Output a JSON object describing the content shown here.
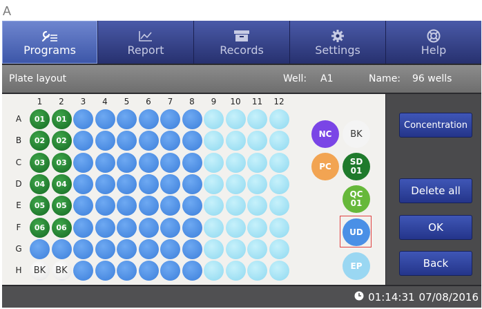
{
  "figure_label": "A",
  "nav": {
    "tabs": [
      {
        "label": "Programs",
        "icon": "wrench-icon",
        "active": true
      },
      {
        "label": "Report",
        "icon": "chart-icon",
        "active": false
      },
      {
        "label": "Records",
        "icon": "archive-icon",
        "active": false
      },
      {
        "label": "Settings",
        "icon": "gear-icon",
        "active": false
      },
      {
        "label": "Help",
        "icon": "lifebuoy-icon",
        "active": false
      }
    ]
  },
  "header": {
    "title": "Plate layout",
    "well_label": "Well:",
    "well_value": "A1",
    "name_label": "Name:",
    "name_value": "96 wells"
  },
  "plate": {
    "columns": [
      "1",
      "2",
      "3",
      "4",
      "5",
      "6",
      "7",
      "8",
      "9",
      "10",
      "11",
      "12"
    ],
    "rows": [
      "A",
      "B",
      "C",
      "D",
      "E",
      "F",
      "G",
      "H"
    ],
    "cells": [
      [
        {
          "type": "std",
          "text": "01"
        },
        {
          "type": "std",
          "text": "01"
        },
        {
          "type": "blue",
          "text": ""
        },
        {
          "type": "blue",
          "text": ""
        },
        {
          "type": "blue",
          "text": ""
        },
        {
          "type": "blue",
          "text": ""
        },
        {
          "type": "blue",
          "text": ""
        },
        {
          "type": "blue",
          "text": ""
        },
        {
          "type": "cyan",
          "text": ""
        },
        {
          "type": "cyan",
          "text": ""
        },
        {
          "type": "cyan",
          "text": ""
        },
        {
          "type": "cyan",
          "text": ""
        }
      ],
      [
        {
          "type": "std",
          "text": "02"
        },
        {
          "type": "std",
          "text": "02"
        },
        {
          "type": "blue",
          "text": ""
        },
        {
          "type": "blue",
          "text": ""
        },
        {
          "type": "blue",
          "text": ""
        },
        {
          "type": "blue",
          "text": ""
        },
        {
          "type": "blue",
          "text": ""
        },
        {
          "type": "blue",
          "text": ""
        },
        {
          "type": "cyan",
          "text": ""
        },
        {
          "type": "cyan",
          "text": ""
        },
        {
          "type": "cyan",
          "text": ""
        },
        {
          "type": "cyan",
          "text": ""
        }
      ],
      [
        {
          "type": "std",
          "text": "03"
        },
        {
          "type": "std",
          "text": "03"
        },
        {
          "type": "blue",
          "text": ""
        },
        {
          "type": "blue",
          "text": ""
        },
        {
          "type": "blue",
          "text": ""
        },
        {
          "type": "blue",
          "text": ""
        },
        {
          "type": "blue",
          "text": ""
        },
        {
          "type": "blue",
          "text": ""
        },
        {
          "type": "cyan",
          "text": ""
        },
        {
          "type": "cyan",
          "text": ""
        },
        {
          "type": "cyan",
          "text": ""
        },
        {
          "type": "cyan",
          "text": ""
        }
      ],
      [
        {
          "type": "std",
          "text": "04"
        },
        {
          "type": "std",
          "text": "04"
        },
        {
          "type": "blue",
          "text": ""
        },
        {
          "type": "blue",
          "text": ""
        },
        {
          "type": "blue",
          "text": ""
        },
        {
          "type": "blue",
          "text": ""
        },
        {
          "type": "blue",
          "text": ""
        },
        {
          "type": "blue",
          "text": ""
        },
        {
          "type": "cyan",
          "text": ""
        },
        {
          "type": "cyan",
          "text": ""
        },
        {
          "type": "cyan",
          "text": ""
        },
        {
          "type": "cyan",
          "text": ""
        }
      ],
      [
        {
          "type": "std",
          "text": "05"
        },
        {
          "type": "std",
          "text": "05"
        },
        {
          "type": "blue",
          "text": ""
        },
        {
          "type": "blue",
          "text": ""
        },
        {
          "type": "blue",
          "text": ""
        },
        {
          "type": "blue",
          "text": ""
        },
        {
          "type": "blue",
          "text": ""
        },
        {
          "type": "blue",
          "text": ""
        },
        {
          "type": "cyan",
          "text": ""
        },
        {
          "type": "cyan",
          "text": ""
        },
        {
          "type": "cyan",
          "text": ""
        },
        {
          "type": "cyan",
          "text": ""
        }
      ],
      [
        {
          "type": "std",
          "text": "06"
        },
        {
          "type": "std",
          "text": "06"
        },
        {
          "type": "blue",
          "text": ""
        },
        {
          "type": "blue",
          "text": ""
        },
        {
          "type": "blue",
          "text": ""
        },
        {
          "type": "blue",
          "text": ""
        },
        {
          "type": "blue",
          "text": ""
        },
        {
          "type": "blue",
          "text": ""
        },
        {
          "type": "cyan",
          "text": ""
        },
        {
          "type": "cyan",
          "text": ""
        },
        {
          "type": "cyan",
          "text": ""
        },
        {
          "type": "cyan",
          "text": ""
        }
      ],
      [
        {
          "type": "blue",
          "text": ""
        },
        {
          "type": "blue",
          "text": ""
        },
        {
          "type": "blue",
          "text": ""
        },
        {
          "type": "blue",
          "text": ""
        },
        {
          "type": "blue",
          "text": ""
        },
        {
          "type": "blue",
          "text": ""
        },
        {
          "type": "blue",
          "text": ""
        },
        {
          "type": "blue",
          "text": ""
        },
        {
          "type": "cyan",
          "text": ""
        },
        {
          "type": "cyan",
          "text": ""
        },
        {
          "type": "cyan",
          "text": ""
        },
        {
          "type": "cyan",
          "text": ""
        }
      ],
      [
        {
          "type": "bk",
          "text": "BK"
        },
        {
          "type": "bk",
          "text": "BK"
        },
        {
          "type": "blue",
          "text": ""
        },
        {
          "type": "blue",
          "text": ""
        },
        {
          "type": "blue",
          "text": ""
        },
        {
          "type": "blue",
          "text": ""
        },
        {
          "type": "blue",
          "text": ""
        },
        {
          "type": "blue",
          "text": ""
        },
        {
          "type": "cyan",
          "text": ""
        },
        {
          "type": "cyan",
          "text": ""
        },
        {
          "type": "cyan",
          "text": ""
        },
        {
          "type": "cyan",
          "text": ""
        }
      ]
    ]
  },
  "legend": {
    "nc": {
      "label": "NC",
      "color": "#7a45e6"
    },
    "bk": {
      "label": "BK",
      "color": "#f4f4f4"
    },
    "pc": {
      "label": "PC",
      "color": "#f2a452"
    },
    "sd": {
      "label": "SD",
      "sub": "01",
      "color": "#1f7a2c"
    },
    "qc": {
      "label": "QC",
      "sub": "01",
      "color": "#66b83a"
    },
    "ud": {
      "label": "UD",
      "color": "#4a90e6",
      "selected": true
    },
    "ep": {
      "label": "EP",
      "color": "#9ad7f2"
    }
  },
  "buttons": {
    "concentration": "Concentration",
    "delete_all": "Delete all",
    "ok": "OK",
    "back": "Back"
  },
  "status": {
    "time": "01:14:31",
    "date": "07/08/2016",
    "icon": "clock-icon"
  }
}
